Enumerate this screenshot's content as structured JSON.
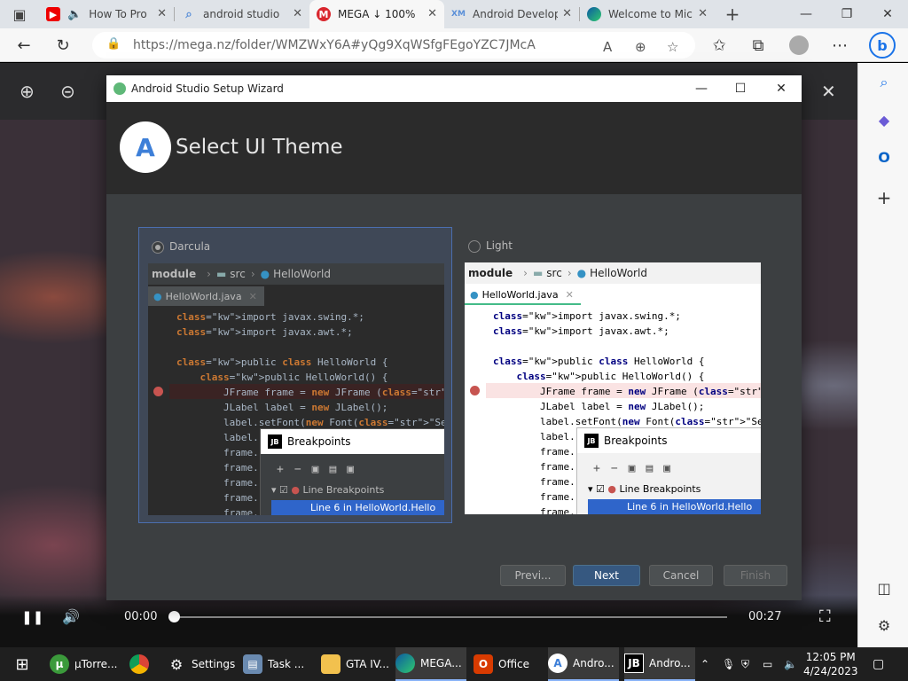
{
  "browser": {
    "tabs": [
      {
        "title": "How To Pro",
        "icon": "youtube-icon",
        "muted_icon": "speaker-icon"
      },
      {
        "title": "android studio",
        "icon": "search-icon"
      },
      {
        "title": "MEGA ↓ 100%",
        "icon": "mega-icon",
        "active": true
      },
      {
        "title": "Android Develop",
        "icon": "xm-icon"
      },
      {
        "title": "Welcome to Mic",
        "icon": "edge-icon"
      }
    ],
    "url": "https://mega.nz/folder/WMZWxY6A#yQg9XqWSfgFEgoYZC7JMcA"
  },
  "mega": {
    "time_current": "00:00",
    "time_total": "00:27",
    "progress": 0
  },
  "wizard": {
    "window_title": "Android Studio Setup Wizard",
    "header_title": "Select UI Theme",
    "themes": [
      {
        "label": "Darcula",
        "selected": true
      },
      {
        "label": "Light",
        "selected": false
      }
    ],
    "preview": {
      "crumb_module": "module",
      "crumb_src": "src",
      "crumb_class": "HelloWorld",
      "file_tab": "HelloWorld.java",
      "code_lines": [
        "import javax.swing.*;",
        "import javax.awt.*;",
        "",
        "public class HelloWorld {",
        "    public HelloWorld() {",
        "        JFrame frame = new JFrame (\"Hello wo",
        "        JLabel label = new JLabel();",
        "        label.setFont(new Font(\"Serif\", Font",
        "        label.",
        "        frame.",
        "        frame.",
        "        frame.",
        "        frame.",
        "        frame."
      ],
      "popup_title": "Breakpoints",
      "tree_group": "Line Breakpoints",
      "tree_item": "Line 6 in HelloWorld.Hello"
    },
    "buttons": {
      "previous": "Previ...",
      "next": "Next",
      "cancel": "Cancel",
      "finish": "Finish"
    }
  },
  "taskbar": {
    "items": [
      {
        "label": "µTorre...",
        "icon": "utorrent-icon"
      },
      {
        "label": "",
        "icon": "chrome-icon"
      },
      {
        "label": "Settings",
        "icon": "gear-icon"
      },
      {
        "label": "Task ...",
        "icon": "task-manager-icon"
      },
      {
        "label": "GTA IV...",
        "icon": "folder-icon"
      },
      {
        "label": "MEGA...",
        "icon": "edge-icon"
      },
      {
        "label": "Office",
        "icon": "office-icon"
      },
      {
        "label": "Andro...",
        "icon": "android-studio-icon"
      },
      {
        "label": "Andro...",
        "icon": "jetbrains-icon"
      }
    ],
    "time": "12:05 PM",
    "date": "4/24/2023"
  }
}
